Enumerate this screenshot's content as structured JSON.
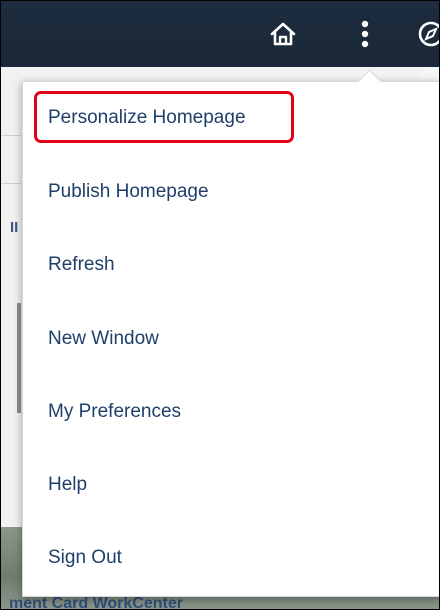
{
  "header": {
    "icons": [
      "home-icon",
      "actions-menu-icon",
      "navbar-icon"
    ]
  },
  "menu": {
    "items": [
      {
        "label": "Personalize Homepage"
      },
      {
        "label": "Publish Homepage"
      },
      {
        "label": "Refresh"
      },
      {
        "label": "New Window"
      },
      {
        "label": "My Preferences"
      },
      {
        "label": "Help"
      },
      {
        "label": "Sign Out"
      }
    ],
    "highlight_color": "#e3001b",
    "text_color": "#1f3f6a"
  },
  "background": {
    "letter": "II",
    "tile_title": "ment Card WorkCenter"
  },
  "colors": {
    "banner": "#1d2c3e"
  }
}
